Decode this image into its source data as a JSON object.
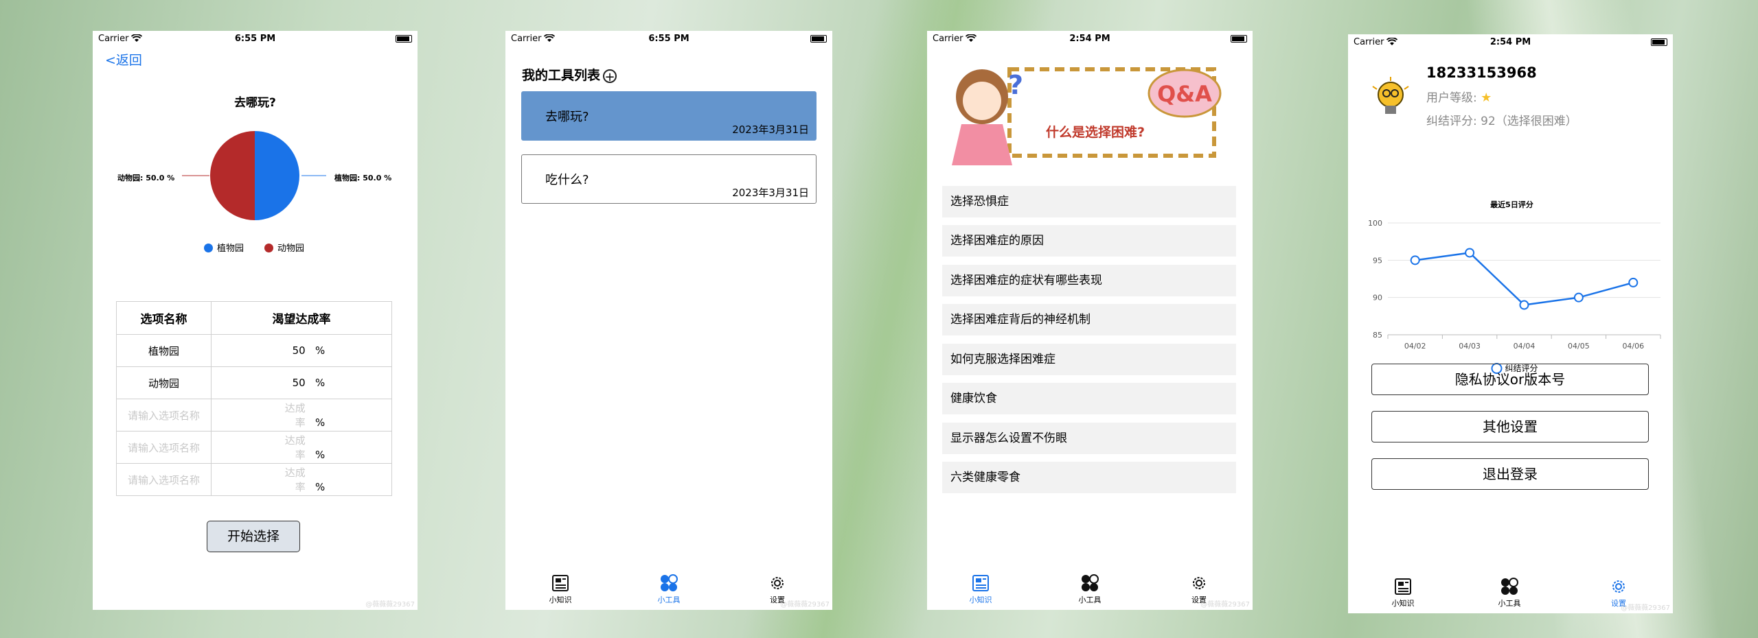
{
  "status": {
    "carrier": "Carrier",
    "time_a": "6:55 PM",
    "time_b": "2:54 PM"
  },
  "tabs": {
    "knowledge": "小知识",
    "tools": "小工具",
    "settings": "设置"
  },
  "watermark": "@薇薇薇29367",
  "screen1": {
    "back": "<返回",
    "title": "去哪玩?",
    "pie_left_label": "动物园: 50.0 %",
    "pie_right_label": "植物园: 50.0 %",
    "legend": [
      "植物园",
      "动物园"
    ],
    "colors": {
      "plant": "#1a73e8",
      "zoo": "#b42a2a"
    },
    "table_headers": [
      "选项名称",
      "渴望达成率"
    ],
    "rows": [
      {
        "name": "植物园",
        "rate": "50",
        "unit": "%"
      },
      {
        "name": "动物园",
        "rate": "50",
        "unit": "%"
      }
    ],
    "placeholders": {
      "name": "请输入选项名称",
      "rate": "达成率",
      "unit": "%"
    },
    "start_button": "开始选择",
    "chart_data": {
      "type": "pie",
      "title": "去哪玩?",
      "slices": [
        {
          "label": "植物园",
          "value": 50.0
        },
        {
          "label": "动物园",
          "value": 50.0
        }
      ],
      "legend": "bottom"
    }
  },
  "screen2": {
    "title": "我的工具列表",
    "plus": "+",
    "items": [
      {
        "name": "去哪玩?",
        "date": "2023年3月31日",
        "selected": true
      },
      {
        "name": "吃什么?",
        "date": "2023年3月31日",
        "selected": false
      }
    ],
    "selected_color": "#6495cd"
  },
  "screen3": {
    "banner_text": "什么是选择困难?",
    "banner_badge": "Q&A",
    "items": [
      "选择恐惧症",
      "选择困难症的原因",
      "选择困难症的症状有哪些表现",
      "选择困难症背后的神经机制",
      "如何克服选择困难症",
      "健康饮食",
      "显示器怎么设置不伤眼",
      "六类健康零食"
    ]
  },
  "screen4": {
    "phone": "18233153968",
    "level_label": "用户等级:",
    "score_label": "纠结评分: 92（选择很困难）",
    "star": "★",
    "chart_data": {
      "type": "line",
      "title": "最近5日评分",
      "x": [
        "04/02",
        "04/03",
        "04/04",
        "04/05",
        "04/06"
      ],
      "series": [
        {
          "name": "纠结评分",
          "values": [
            95,
            96,
            89,
            90,
            92
          ]
        }
      ],
      "ylim": [
        85,
        100
      ],
      "yticks": [
        85,
        90,
        95,
        100
      ],
      "grid": true,
      "legend": "bottom",
      "color": "#1a73e8"
    },
    "buttons": [
      "隐私协议or版本号",
      "其他设置",
      "退出登录"
    ]
  }
}
